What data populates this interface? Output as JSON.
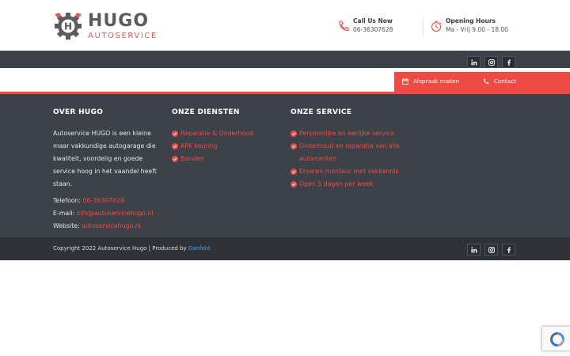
{
  "brand": {
    "name": "HUGO",
    "subtitle": "AUTOSERVICE",
    "accent_color": "#ef4a43",
    "dark_color": "#3d4249"
  },
  "header": {
    "call": {
      "title": "Call Us Now",
      "value": "06-36307628",
      "icon": "phone-icon"
    },
    "hours": {
      "title": "Opening Hours",
      "value": "Ma - Vrij 9.00 - 18.00",
      "icon": "stopwatch-icon"
    }
  },
  "social": [
    {
      "name": "linkedin",
      "label": "in"
    },
    {
      "name": "instagram",
      "label": ""
    },
    {
      "name": "facebook",
      "label": "f"
    }
  ],
  "cta": {
    "appointment_label": "Afspraak maken",
    "contact_label": "Contact"
  },
  "footer": {
    "about": {
      "heading": "OVER HUGO",
      "text": "Autoservice HUGO is een kleine maar vakkundige autogarage die kwaliteit, voordelig en goede service hoog in het vaandel heeft staan.",
      "phone_label": "Telefoon:",
      "phone": "06-36307628",
      "email_label": "E-mail:",
      "email": "info@autoservicehugo.nl",
      "website_label": "Website:",
      "website": "autoservicehugo.nl"
    },
    "services": {
      "heading": "ONZE DIENSTEN",
      "items": [
        "Reparatie & Onderhoud",
        "APK keuring",
        "Banden"
      ]
    },
    "service": {
      "heading": "ONZE SERVICE",
      "items": [
        "Persoonlijke en eerlijke service",
        "Onderhoud en reparatie van alle automerken",
        "Ervaren monteur met vakkennis",
        "Open 5 dagen per week"
      ]
    }
  },
  "copyright": {
    "text": "Copyright 2022 Autoservice Hugo | Produced by",
    "producer": "Danfold"
  }
}
